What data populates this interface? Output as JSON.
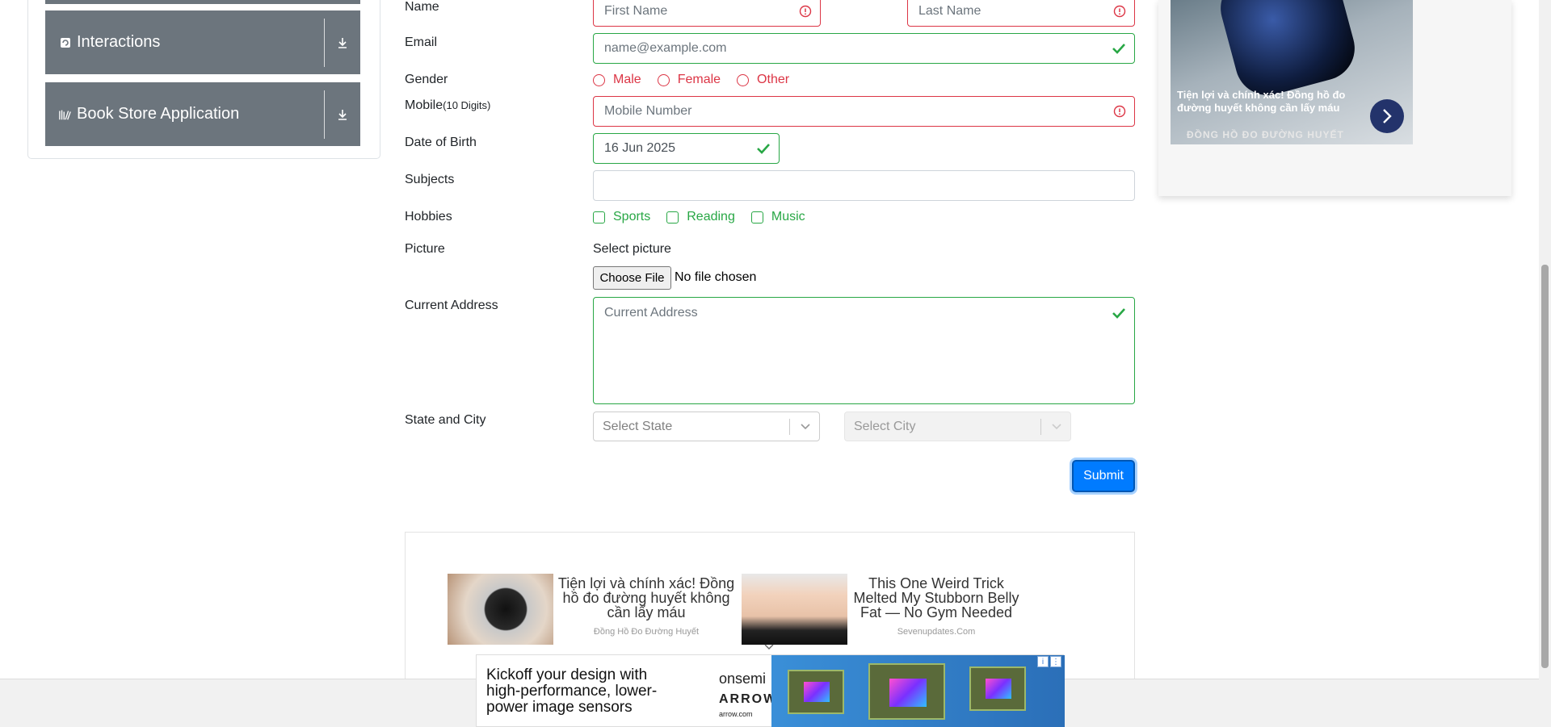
{
  "sidebar": {
    "groups": [
      {
        "label": "Interactions",
        "icon": "interactions-icon"
      },
      {
        "label": "Book Store Application",
        "icon": "book-icon"
      }
    ]
  },
  "form": {
    "name_label": "Name",
    "first_name_placeholder": "First Name",
    "last_name_placeholder": "Last Name",
    "email_label": "Email",
    "email_placeholder": "name@example.com",
    "gender_label": "Gender",
    "gender_options": [
      "Male",
      "Female",
      "Other"
    ],
    "mobile_label": "Mobile",
    "mobile_hint": "(10 Digits)",
    "mobile_placeholder": "Mobile Number",
    "dob_label": "Date of Birth",
    "dob_value": "16 Jun 2025",
    "subjects_label": "Subjects",
    "subjects_value": "",
    "hobbies_label": "Hobbies",
    "hobbies_options": [
      "Sports",
      "Reading",
      "Music"
    ],
    "picture_label": "Picture",
    "select_picture_label": "Select picture",
    "choose_file_label": "Choose File",
    "no_file_text": "No file chosen",
    "address_label": "Current Address",
    "address_placeholder": "Current Address",
    "state_city_label": "State and City",
    "state_placeholder": "Select State",
    "city_placeholder": "Select City",
    "submit_label": "Submit"
  },
  "right_ad": {
    "text": "Tiện lợi và chính xác! Đồng hồ đo đường huyết không cần lấy máu",
    "brand": "ĐỒNG HỒ ĐO ĐƯỜNG HUYẾT"
  },
  "bottom_ads": [
    {
      "title": "Tiện lợi và chính xác! Đồng hồ đo đường huyết không cần lấy máu",
      "source": "Đồng Hồ Đo Đường Huyết"
    },
    {
      "title": "This One Weird Trick Melted My Stubborn Belly Fat — No Gym Needed",
      "source": "Sevenupdates.Com"
    }
  ],
  "banner_ad": {
    "text": "Kickoff your design with high-performance, lower-power image sensors",
    "logo1": "onsemi",
    "logo2": "ARROW",
    "logo2_sub": "arrow.com"
  },
  "colors": {
    "invalid": "#dc3545",
    "valid": "#28a745",
    "primary": "#007bff",
    "sidebar_group": "#6c757d"
  }
}
